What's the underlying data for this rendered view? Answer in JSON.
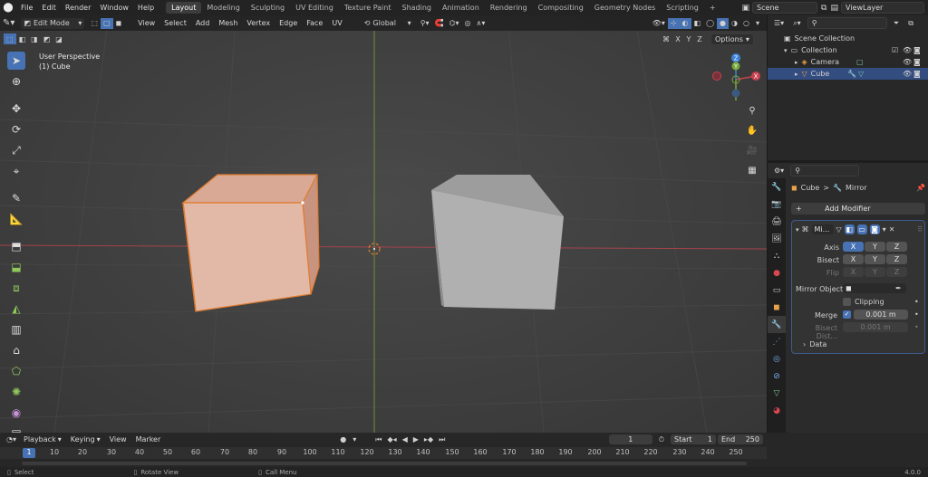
{
  "topbar": {
    "menus": [
      "File",
      "Edit",
      "Render",
      "Window",
      "Help"
    ],
    "workspaces": [
      "Layout",
      "Modeling",
      "Sculpting",
      "UV Editing",
      "Texture Paint",
      "Shading",
      "Animation",
      "Rendering",
      "Compositing",
      "Geometry Nodes",
      "Scripting"
    ],
    "active_workspace": "Layout",
    "add_tab": "+",
    "scene": "Scene",
    "view_layer": "ViewLayer"
  },
  "viewport_header": {
    "mode": "Edit Mode",
    "menus": [
      "View",
      "Select",
      "Add",
      "Mesh",
      "Vertex",
      "Edge",
      "Face",
      "UV"
    ],
    "orientation": "Global",
    "axes": [
      "X",
      "Y",
      "Z"
    ],
    "options": "Options"
  },
  "viewport": {
    "view_name": "User Perspective",
    "object_name": "(1) Cube",
    "gizmo": {
      "x": "X",
      "y": "Y",
      "z": "Z"
    }
  },
  "outliner": {
    "items": [
      {
        "label": "Scene Collection"
      },
      {
        "label": "Collection"
      },
      {
        "label": "Camera"
      },
      {
        "label": "Cube"
      }
    ]
  },
  "properties": {
    "breadcrumb_object": "Cube",
    "breadcrumb_sep": ">",
    "breadcrumb_modifier": "Mirror",
    "add_modifier": "Add Modifier",
    "modifier_name": "Mi...",
    "axis_label": "Axis",
    "bisect_label": "Bisect",
    "flip_label": "Flip",
    "xyz": [
      "X",
      "Y",
      "Z"
    ],
    "mirror_object_label": "Mirror Object",
    "clipping_label": "Clipping",
    "merge_label": "Merge",
    "merge_value": "0.001 m",
    "bisect_dist_label": "Bisect Dist...",
    "bisect_dist_value": "0.001 m",
    "data_label": "Data"
  },
  "timeline": {
    "menus": [
      "Playback",
      "Keying",
      "View",
      "Marker"
    ],
    "current_frame": "1",
    "start_label": "Start",
    "start_value": "1",
    "end_label": "End",
    "end_value": "250",
    "ticks": [
      "1",
      "10",
      "20",
      "30",
      "40",
      "50",
      "60",
      "70",
      "80",
      "90",
      "100",
      "110",
      "120",
      "130",
      "140",
      "150",
      "160",
      "170",
      "180",
      "190",
      "200",
      "210",
      "220",
      "230",
      "240",
      "250"
    ]
  },
  "status": {
    "select": "Select",
    "rotate": "Rotate View",
    "call_menu": "Call Menu",
    "version": "4.0.0"
  },
  "colors": {
    "accent": "#4772b3",
    "selection_orange": "#e07b2f",
    "x_axis": "#c8414f",
    "y_axis": "#76a83a",
    "z_axis": "#3b82d6"
  }
}
